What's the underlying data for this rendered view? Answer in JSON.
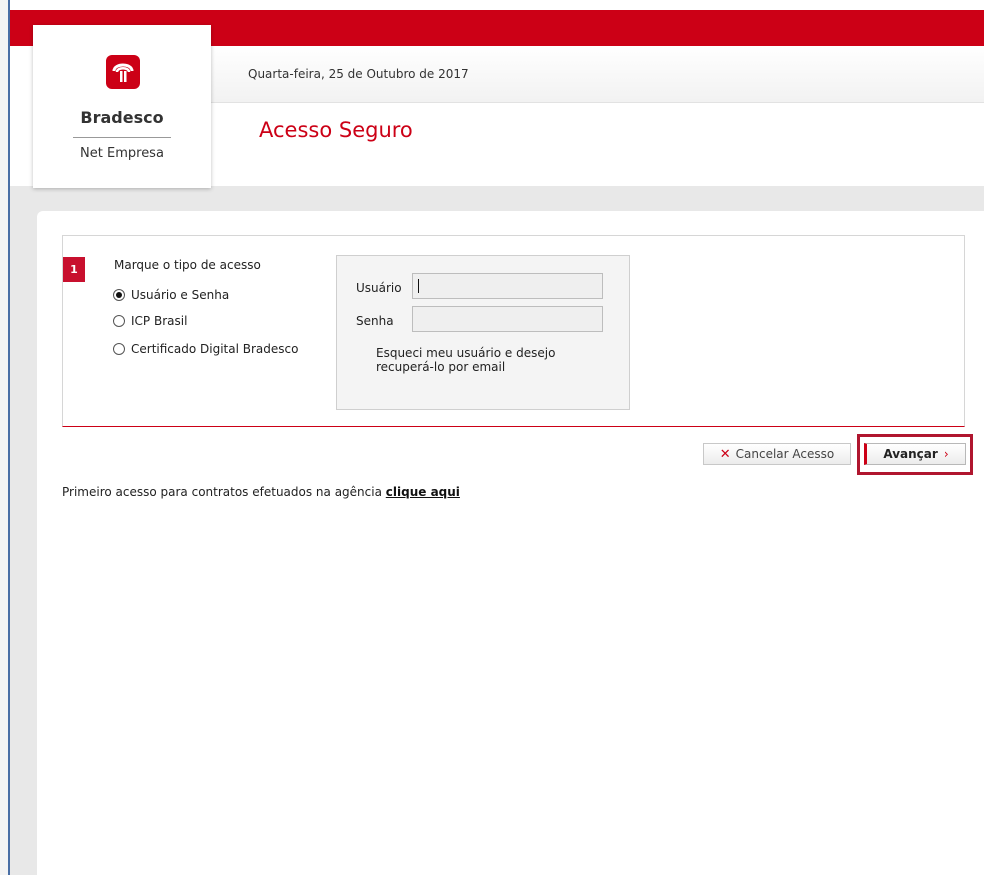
{
  "header": {
    "date": "Quarta-feira, 25 de Outubro de 2017",
    "title": "Acesso Seguro"
  },
  "logo": {
    "name": "Bradesco",
    "subtitle": "Net Empresa"
  },
  "step": {
    "number": "1",
    "label": "Marque o tipo de acesso",
    "options": [
      {
        "label": "Usuário e Senha",
        "selected": true
      },
      {
        "label": "ICP Brasil",
        "selected": false
      },
      {
        "label": "Certificado Digital Bradesco",
        "selected": false
      }
    ]
  },
  "login": {
    "user_label": "Usuário",
    "user_value": "",
    "password_label": "Senha",
    "password_value": "",
    "recover_text": "Esqueci meu usuário e desejo recuperá-lo por email"
  },
  "actions": {
    "cancel_label": "Cancelar Acesso",
    "next_label": "Avançar"
  },
  "first_access": {
    "text": "Primeiro acesso para contratos efetuados na agência",
    "link": "clique aqui"
  },
  "colors": {
    "brand_red": "#cc0016",
    "badge_red": "#c8102e"
  },
  "icons": {
    "logo": "bradesco-tree-icon",
    "cancel": "close-icon",
    "next": "chevron-right-icon"
  }
}
